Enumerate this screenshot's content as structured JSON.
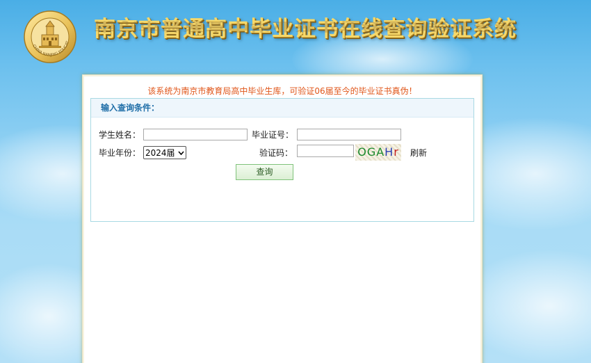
{
  "header": {
    "title": "南京市普通高中毕业证书在线查询验证系统",
    "logo_icon": "nanjing-education-emblem-icon",
    "logo_text": "CHINA NANJING EDUCATION"
  },
  "notice": "该系统为南京市教育局高中毕业生库，可验证06届至今的毕业证书真伪！",
  "form": {
    "section_title": "输入查询条件：",
    "name_label": "学生姓名：",
    "name_value": "",
    "cert_label": "毕业证号：",
    "cert_value": "",
    "year_label": "毕业年份：",
    "year_selected": "2024届",
    "code_label": "验证码：",
    "code_value": "",
    "captcha_chars": [
      "O",
      "G",
      "A",
      "H",
      "r"
    ],
    "refresh_label": "刷新",
    "submit_label": "查询"
  },
  "colors": {
    "notice_text": "#e0561a",
    "section_title": "#1f6ea8",
    "title_gold": "#f6d86a"
  }
}
